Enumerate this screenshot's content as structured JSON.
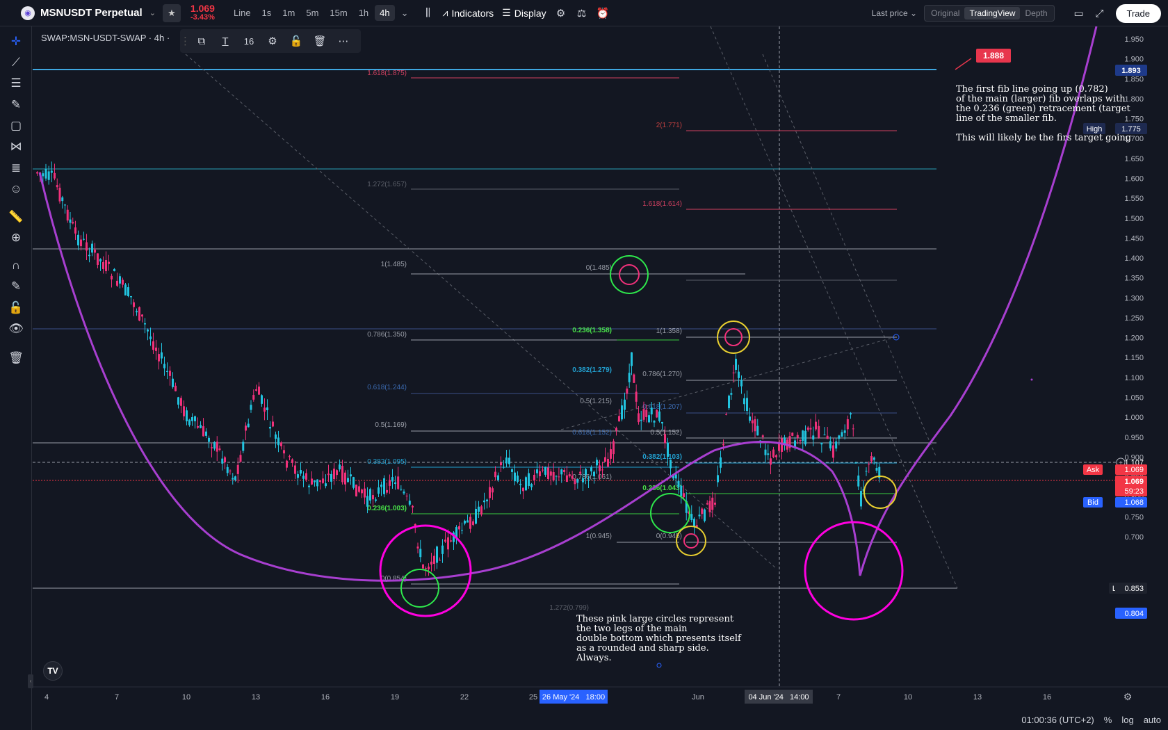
{
  "header": {
    "symbol": "MSNUSDT Perpetual",
    "last_price": "1.069",
    "change_pct": "-3.43%",
    "chart_type_label": "Line",
    "timeframes": [
      "1s",
      "1m",
      "5m",
      "15m",
      "1h",
      "4h"
    ],
    "active_timeframe": "4h",
    "indicators_label": "Indicators",
    "display_label": "Display",
    "price_source_label": "Last price",
    "view_modes": [
      "Original",
      "TradingView",
      "Depth"
    ],
    "active_view_mode": "TradingView",
    "trade_label": "Trade"
  },
  "legend": {
    "title": "SWAP:MSN-USDT-SWAP · 4h ·"
  },
  "drawing_toolbar": {
    "font_size": "16"
  },
  "price_axis": {
    "ticks": [
      "1.950",
      "1.900",
      "1.850",
      "1.800",
      "1.750",
      "1.700",
      "1.650",
      "1.600",
      "1.550",
      "1.500",
      "1.450",
      "1.400",
      "1.350",
      "1.300",
      "1.250",
      "1.200",
      "1.150",
      "1.100",
      "1.050",
      "1.000",
      "0.950",
      "0.900",
      "0.850",
      "0.800",
      "0.750",
      "0.700"
    ],
    "labels": {
      "top_line": "1.893",
      "high_tag": "High",
      "high_value": "1.775",
      "crosshair": "1.107",
      "ask_tag": "Ask",
      "ask_value": "1.069",
      "last_value": "1.069",
      "countdown": "59:23",
      "bid_tag": "Bid",
      "bid_value": "1.068",
      "low_tag": "Low",
      "low_value": "0.853",
      "blue_label": "0.804"
    },
    "callout": "1.888"
  },
  "time_axis": {
    "ticks": [
      "4",
      "7",
      "10",
      "13",
      "16",
      "19",
      "22",
      "25",
      "Jun",
      "7",
      "10",
      "13",
      "16",
      "19"
    ],
    "crosshair_label_1": "26 May '24   18:00",
    "crosshair_label_2": "04 Jun '24   14:00"
  },
  "fib_labels": {
    "big": [
      "1.618(1.875)",
      "1.272(1.657)",
      "1(1.485)",
      "0.786(1.350)",
      "0.618(1.244)",
      "0.5(1.169)",
      "0.382(1.095)",
      "0.236(1.003)",
      "0(0.854)",
      "1.272(0.799)"
    ],
    "mid": [
      "0(1.485)",
      "0.236(1.358)",
      "0.382(1.279)",
      "0.5(1.215)",
      "0.618(1.152)",
      "0.786(1.061)",
      "1(0.945)"
    ],
    "small": [
      "2(1.771)",
      "1.618(1.614)",
      "1(1.358)",
      "0.786(1.270)",
      "0.618(1.207)",
      "0.5(1.152)",
      "0.382(1.103)",
      "0.236(1.043)",
      "0(0.945)"
    ]
  },
  "notes": {
    "top_right": "The first fib line going up (0.782)\nof the main (larger) fib overlaps with\nthe 0.236 (green) retracement (target\nline of the smaller fib.\n\nThis will likely be the firs target going",
    "bottom": "These pink large circles represent\nthe two legs of the main\ndouble bottom which presents itself\nas a rounded and sharp side.\nAlways."
  },
  "status": {
    "clock": "01:00:36 (UTC+2)",
    "percent": "%",
    "log": "log",
    "auto": "auto"
  },
  "colors": {
    "background": "#131722",
    "bull": "#22c4e0",
    "bear": "#f0317a",
    "curve": "#a83fd0",
    "pink_circle": "#ff00e0",
    "green_circle": "#2ee84c",
    "yellow_circle": "#e8cf30"
  }
}
